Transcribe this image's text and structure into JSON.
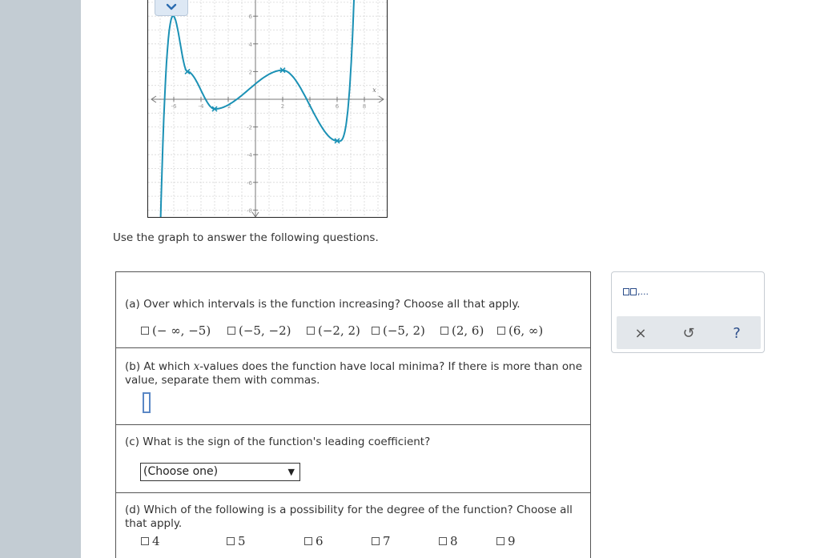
{
  "graph": {
    "x_axis_letter": "x",
    "x_tick_labels": [
      "-6",
      "-4",
      "-2",
      "2",
      "4",
      "6",
      "8"
    ],
    "y_tick_labels": [
      "6",
      "4",
      "2",
      "-2",
      "-4",
      "-6",
      "-8"
    ],
    "curve_color": "#1b91b5",
    "marker_color": "#1b91b5",
    "grid_color": "#d8d8d8"
  },
  "instruction": "Use the graph to answer the following questions.",
  "part_a": {
    "question": "(a) Over which intervals is the function increasing? Choose all that apply.",
    "options": [
      "(− ∞, −5)",
      "(−5, −2)",
      "(−2, 2)",
      "(−5, 2)",
      "(2, 6)",
      "(6, ∞)"
    ]
  },
  "part_b": {
    "question_pre": "(b) At which ",
    "question_var": "x",
    "question_post": "-values does the function have local minima? If there is more than one value, separate them with commas.",
    "answer": ""
  },
  "part_c": {
    "question": "(c) What is the sign of the function's leading coefficient?",
    "select_value": "(Choose one)"
  },
  "part_d": {
    "question": "(d) Which of the following is a possibility for the degree of the function? Choose all that apply.",
    "options": [
      "4",
      "5",
      "6",
      "7",
      "8",
      "9"
    ]
  },
  "toolbox": {
    "format_icon_suffix": ",...",
    "clear_symbol": "×",
    "undo_symbol": "↺",
    "help_symbol": "?",
    "accent_color": "#2b4d8a"
  }
}
